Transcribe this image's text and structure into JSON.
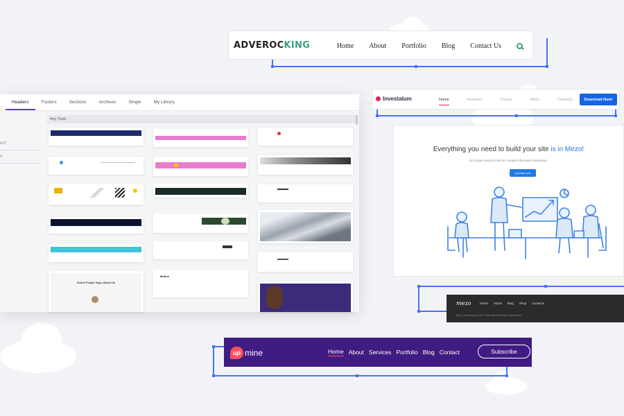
{
  "adverocking": {
    "logo_main": "ADVEROC",
    "logo_accent": "KING",
    "nav": [
      "Home",
      "About",
      "Portfolio",
      "Blog",
      "Contact Us"
    ],
    "accent_color": "#3aa27b",
    "search_icon": "search-icon"
  },
  "library": {
    "tabs": [
      "Headers",
      "Footers",
      "Sections",
      "Archives",
      "Single",
      "My Library"
    ],
    "active_tab": "Headers",
    "side_items": [
      "ULT",
      "S"
    ],
    "topic_filter": "Any Topic",
    "thumb_sample_heading": "Select People Says About Us",
    "thumb_sample_brand": "Mokroi"
  },
  "investalum": {
    "logo": "Investalum",
    "nav": [
      "Home",
      "Features",
      "Pricing",
      "FAQs",
      "Contacts"
    ],
    "active": "Home",
    "cta": "Download Now!",
    "accent_color": "#1565e6"
  },
  "mezo_hero": {
    "title_main": "Everything you need to build your site ",
    "title_highlight": "is in Mezo!",
    "subtitle": "No longer need to look for complex decisions elsewhere.",
    "button": "purchase now",
    "accent_color": "#1e7be8"
  },
  "mezo_footer": {
    "logo": "mezo",
    "nav": [
      "Home",
      "About",
      "Blog",
      "Shop",
      "Contacts"
    ],
    "copyright": "Mezo | Multipurpose WP Theme with Elementor Page Builder"
  },
  "upmine": {
    "logo_badge": "up",
    "logo_word": "mine",
    "nav": [
      "Home",
      "About",
      "Services",
      "Portfolio",
      "Blog",
      "Contact"
    ],
    "active": "Home",
    "cta": "Subscribe",
    "bg_color": "#3f1b82",
    "accent_color": "#ff4f5e"
  }
}
